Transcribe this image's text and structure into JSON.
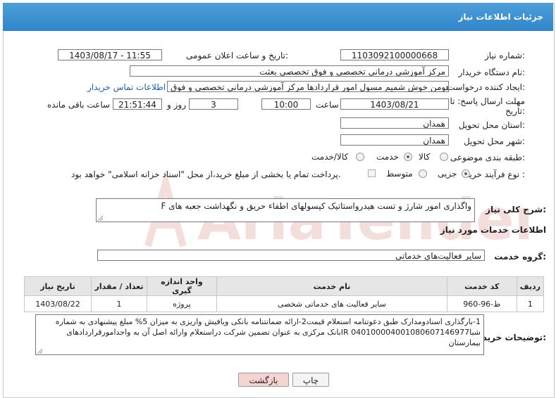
{
  "header": {
    "title": "جزئیات اطلاعات نیاز"
  },
  "fields": {
    "need_number_label": "شماره نیاز:",
    "need_number": "1103092100000668",
    "announce_label": "تاریخ و ساعت اعلان عمومی:",
    "announce_value": "1403/08/17 - 11:55",
    "buyer_org_label": "نام دستگاه خریدار:",
    "buyer_org": "مرکز آموزشي درماني تخصصي و فوق تخصصي بعثت",
    "requester_label": "ایجاد کننده درخواست:",
    "requester": "هومن خوش شمیم مسول امور قراردادها مرکز آموزشی درمانی تخصصی و فوق",
    "contact_link": "اطلاعات تماس خریدار",
    "deadline_label_1": "مهلت ارسال پاسخ: تا",
    "deadline_label_2": "تاریخ:",
    "deadline_date": "1403/08/21",
    "time_label": "ساعت",
    "deadline_time": "10:00",
    "days_value": "3",
    "days_label": "روز و",
    "remaining_time": "21:51:44",
    "remaining_label": "ساعت باقی مانده",
    "province_label": "استان محل تحویل:",
    "province": "همدان",
    "city_label": "شهر محل تحویل:",
    "city": "همدان",
    "category_label": "طبقه بندی موضوعی:",
    "category_options": [
      "کالا",
      "خدمت",
      "کالا/خدمت"
    ],
    "process_label": "نوع فرآیند خرید :",
    "process_options": [
      "جزیی",
      "متوسط"
    ],
    "payment_note": "پرداخت تمام یا بخشی از مبلغ خرید،از محل \"اسناد خزانه اسلامی\" خواهد بود."
  },
  "summary": {
    "label": "شرح کلی نیاز:",
    "text": "واگذاری امور شارژ و تست هیدرواستاتیک کپسولهای اطفاء حریق و نگهداشت جعبه های F"
  },
  "services": {
    "section_title": "اطلاعات خدمات مورد نیاز",
    "group_label": "گروه خدمت:",
    "group_value": "سایر فعالیت‌های خدماتی",
    "columns": [
      "ردیف",
      "کد خدمت",
      "نام خدمت",
      "واحد اندازه گیری",
      "تعداد / مقدار",
      "تاریخ نیاز"
    ],
    "rows": [
      [
        "1",
        "ط-96-960",
        "سایر فعالیت های خدماتی شخصی",
        "پروژه",
        "1",
        "1403/08/22"
      ]
    ]
  },
  "buyer_notes": {
    "label": "توضیحات خریدار:",
    "text": "1-بارگذاری اسنادومدارک طبق دعوتنامه استعلام قیمت2-ارائه ضمانتنامه بانکی ویافیش واریزی به میزان 5% مبلغ پیشنهادی به شماره شباIR 040100004001080607146977بانک  مرکزی به عنوان تضمین شرکت دراستعلام وارائه اصل آن به واحدامورقراردادهای بیمارستان"
  },
  "buttons": {
    "print": "چاپ",
    "back": "بازگشت"
  },
  "watermark_text": "AriaTender.net",
  "colors": {
    "header_bg": "#3a8fd0",
    "link": "#1d5fb4",
    "back_btn": "#f7d4d4",
    "watermark": "#c0392b"
  }
}
